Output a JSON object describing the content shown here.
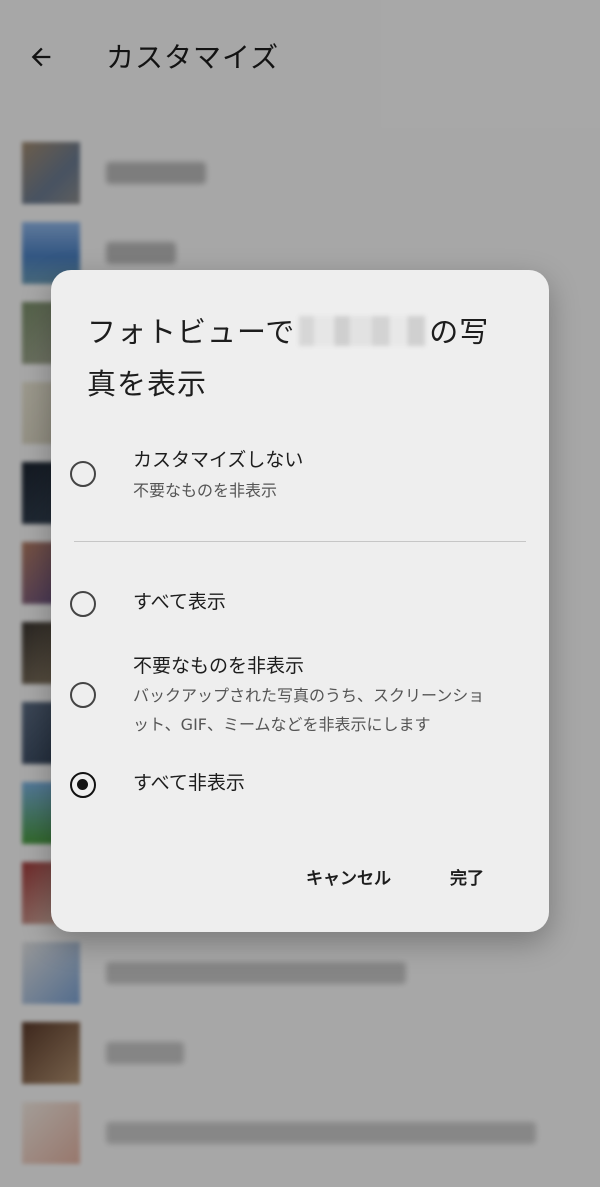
{
  "app_bar": {
    "title": "カスタマイズ",
    "back_icon": "arrow-left-icon"
  },
  "dialog": {
    "title_before": "フォトビューで",
    "title_after": "の写",
    "title_line2": "真を表示",
    "options": [
      {
        "label": "カスタマイズしない",
        "description": "不要なものを非表示",
        "selected": false
      },
      {
        "label": "すべて表示",
        "description": "",
        "selected": false
      },
      {
        "label": "不要なものを非表示",
        "description_line1": "バックアップされた写真のうち、スクリーンショ",
        "description_line2": "ット、GIF、ミームなどを非表示にします",
        "selected": false
      },
      {
        "label": "すべて非表示",
        "description": "",
        "selected": true
      }
    ],
    "cancel_label": "キャンセル",
    "done_label": "完了"
  },
  "colors": {
    "scrim": "#000000",
    "dialog_bg": "#eeeeee",
    "radio_selected": "#111111",
    "radio_unselected": "#444444"
  }
}
